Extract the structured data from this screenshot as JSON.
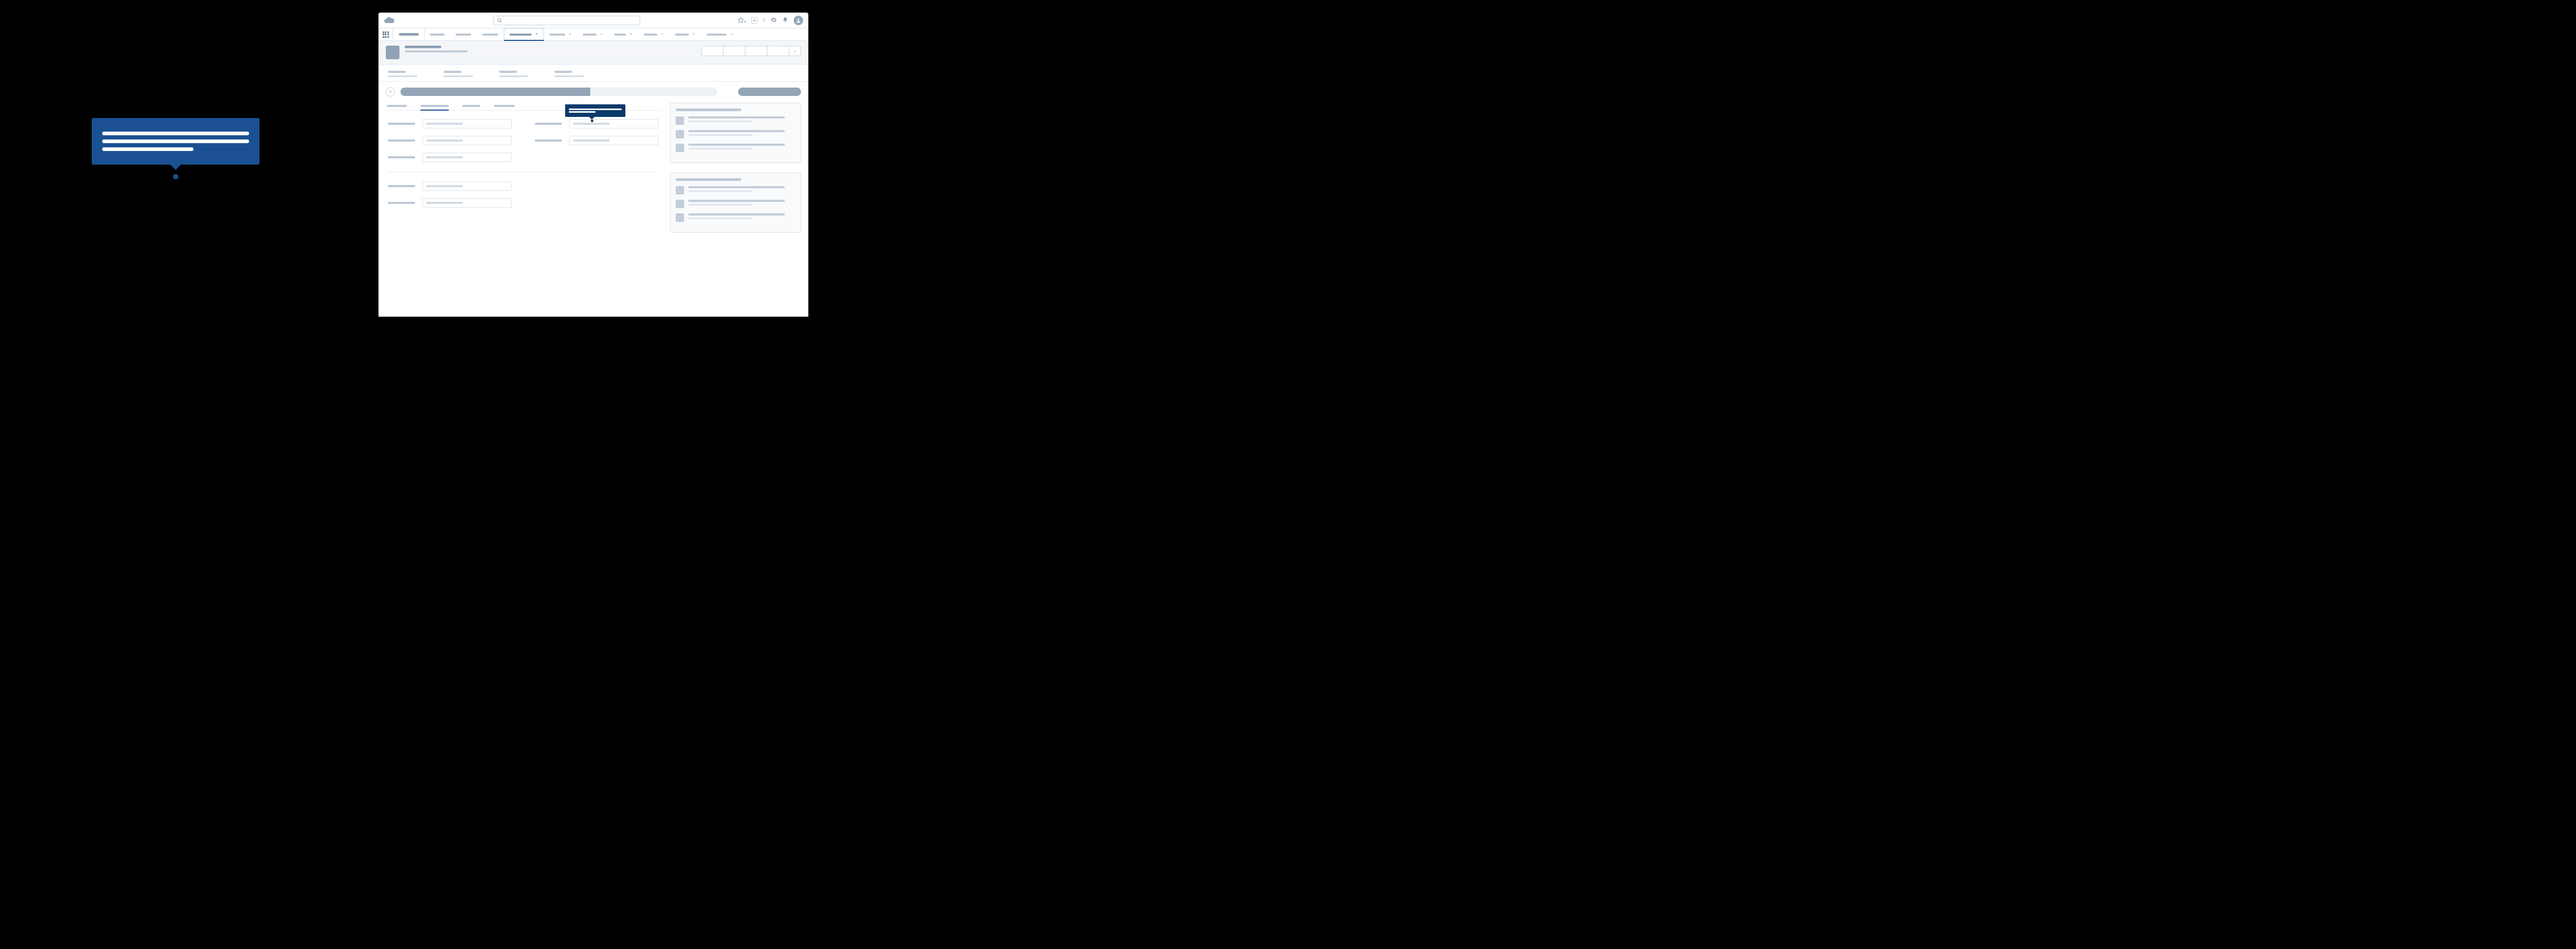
{
  "colors": {
    "popover_bg": "#1b5192",
    "mini_popover_bg": "#0c3a6b",
    "skeleton_mid": "#95a5b8"
  },
  "left_popover": {
    "lines": 3
  },
  "header": {
    "search_placeholder": "",
    "actions": {
      "favorite": "star-icon",
      "add": "plus-icon",
      "help": "help-icon",
      "setup": "gear-icon",
      "notifications": "bell-icon",
      "avatar": "avatar-icon"
    }
  },
  "app_nav": {
    "tabs": [
      {
        "width": 28,
        "chevron": false,
        "active": false
      },
      {
        "width": 30,
        "chevron": false,
        "active": false
      },
      {
        "width": 30,
        "chevron": false,
        "active": false
      },
      {
        "width": 42,
        "chevron": true,
        "active": true
      },
      {
        "width": 30,
        "chevron": true,
        "active": false
      },
      {
        "width": 26,
        "chevron": true,
        "active": false
      },
      {
        "width": 22,
        "chevron": true,
        "active": false
      },
      {
        "width": 26,
        "chevron": true,
        "active": false
      },
      {
        "width": 26,
        "chevron": true,
        "active": false
      },
      {
        "width": 38,
        "chevron": true,
        "active": false
      }
    ]
  },
  "record_header": {
    "action_buttons": 4,
    "has_more": true
  },
  "highlights": {
    "count": 4
  },
  "path": {
    "segments": [
      {
        "state": "done"
      },
      {
        "state": "done"
      },
      {
        "state": "current"
      },
      {
        "state": "pending"
      },
      {
        "state": "pending"
      }
    ]
  },
  "inner_tabs": {
    "tabs": [
      {
        "width": 38,
        "active": false
      },
      {
        "width": 54,
        "active": true
      },
      {
        "width": 34,
        "active": false
      },
      {
        "width": 40,
        "active": false
      }
    ]
  },
  "form": {
    "rows": [
      [
        "field",
        "field"
      ],
      [
        "field",
        "field"
      ],
      [
        "field",
        "blank"
      ],
      [
        "divider"
      ],
      [
        "field",
        "blank"
      ],
      [
        "field",
        "blank"
      ]
    ],
    "mini_popover": {
      "attach_row": 0,
      "attach_col": 1,
      "top": 0,
      "left_col2": 0,
      "width": 115
    }
  },
  "sidebar": {
    "cards": [
      {
        "items": 3
      },
      {
        "items": 3
      }
    ]
  }
}
